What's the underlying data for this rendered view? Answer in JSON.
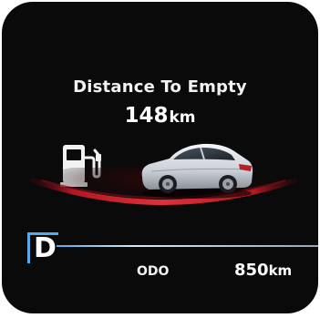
{
  "distance_to_empty": {
    "label": "Distance To Empty",
    "value": "148",
    "unit": "km"
  },
  "gear": {
    "position": "D"
  },
  "odometer": {
    "label": "ODO",
    "value": "850",
    "unit": "km"
  },
  "colors": {
    "background": "#0a0a0a",
    "text": "#ffffff",
    "accent_blue": "#5aa9e6",
    "arc_red": "#c0202a",
    "car_silver": "#d9dde3"
  },
  "icons": {
    "fuel": "fuel-pump-icon",
    "car": "car-icon"
  }
}
